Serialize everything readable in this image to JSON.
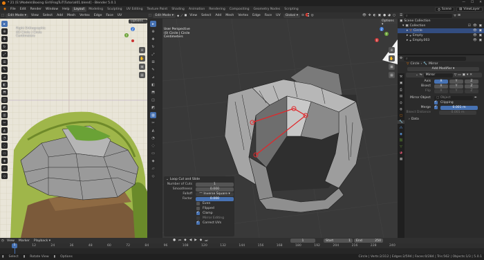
{
  "window": {
    "title": "* 21 [E:\\Models\\Boxing Girl\\FrogTuT\\Tutorial01.blend] - Blender 5.0.1"
  },
  "menubar": {
    "menus": [
      "File",
      "Edit",
      "Render",
      "Window",
      "Help"
    ],
    "workspaces": [
      "Layout",
      "Modeling",
      "Sculpting",
      "UV Editing",
      "Texture Paint",
      "Shading",
      "Animation",
      "Rendering",
      "Compositing",
      "Geometry Nodes",
      "Scripting"
    ],
    "scene_label": "Scene",
    "viewlayer_label": "ViewLayer"
  },
  "left_viewport": {
    "mode": "Edit Mode",
    "menus": [
      "View",
      "Select",
      "Add",
      "Mesh",
      "Vertex",
      "Edge",
      "Face",
      "UV"
    ],
    "options": "Options",
    "overlay_lines": [
      "Right Orthographic",
      "(0) Circle | Circle",
      "Centimeters"
    ]
  },
  "right_viewport": {
    "mode": "Edit Mode",
    "menus": [
      "View",
      "Select",
      "Add",
      "Mesh",
      "Vertex",
      "Edge",
      "Face",
      "UV"
    ],
    "transform": "Global",
    "options": "Options",
    "overlay_lines": [
      "User Perspective",
      "(0) Circle | Circle",
      "Centimeters"
    ]
  },
  "loopcut_panel": {
    "title": "Loop Cut and Slide",
    "fields": [
      {
        "label": "Number of Cuts",
        "value": "1"
      },
      {
        "label": "Smoothness",
        "value": "0.000"
      },
      {
        "label": "Falloff",
        "value": "Inverse Square"
      },
      {
        "label": "Factor",
        "value": "0.000"
      }
    ],
    "checkboxes": [
      {
        "label": "Even",
        "checked": false
      },
      {
        "label": "Flipped",
        "checked": false
      },
      {
        "label": "Clamp",
        "checked": true
      },
      {
        "label": "Mirror Editing",
        "checked": false
      },
      {
        "label": "Correct UVs",
        "checked": true
      }
    ]
  },
  "outliner": {
    "title": "Scene Collection",
    "items": [
      {
        "name": "Collection",
        "indent": 1
      },
      {
        "name": "Circle",
        "indent": 2
      },
      {
        "name": "Empty",
        "indent": 2
      },
      {
        "name": "Empty.003",
        "indent": 2
      }
    ]
  },
  "properties": {
    "breadcrumb": [
      "Circle",
      "Mirror"
    ],
    "add_modifier": "Add Modifier",
    "modifier_name": "Mirror",
    "axis_label": "Axis",
    "bisect_label": "Bisect",
    "flip_label": "Flip",
    "axes": [
      "X",
      "Y",
      "Z"
    ],
    "mirror_object_label": "Mirror Object",
    "mirror_object_placeholder": "Object",
    "clipping_label": "Clipping",
    "merge_label": "Merge",
    "merge_value": "0.001 m",
    "bisect_distance_label": "Bisect Distance",
    "bisect_distance_value": "0.001 m",
    "data_label": "Data"
  },
  "timeline": {
    "menus": [
      "View",
      "Marker",
      "Playback"
    ],
    "current_frame": "1",
    "start_label": "Start",
    "start_value": "1",
    "end_label": "End",
    "end_value": "250",
    "ticks": [
      "1",
      "12",
      "24",
      "36",
      "48",
      "60",
      "72",
      "84",
      "96",
      "108",
      "120",
      "132",
      "144",
      "156",
      "168",
      "180",
      "192",
      "204",
      "216",
      "228",
      "240"
    ]
  },
  "statusbar": {
    "items": [
      "Select",
      "Rotate View",
      "Options"
    ],
    "right": "Circle | Verts:2/312 | Edges:2/594 | Faces:0/284 | Tris:562 | Objects:1/3 | 5.0.1"
  },
  "colors": {
    "accent": "#4772b3",
    "selection_edge": "#e0282b",
    "active_tab": "#e87d0d"
  }
}
